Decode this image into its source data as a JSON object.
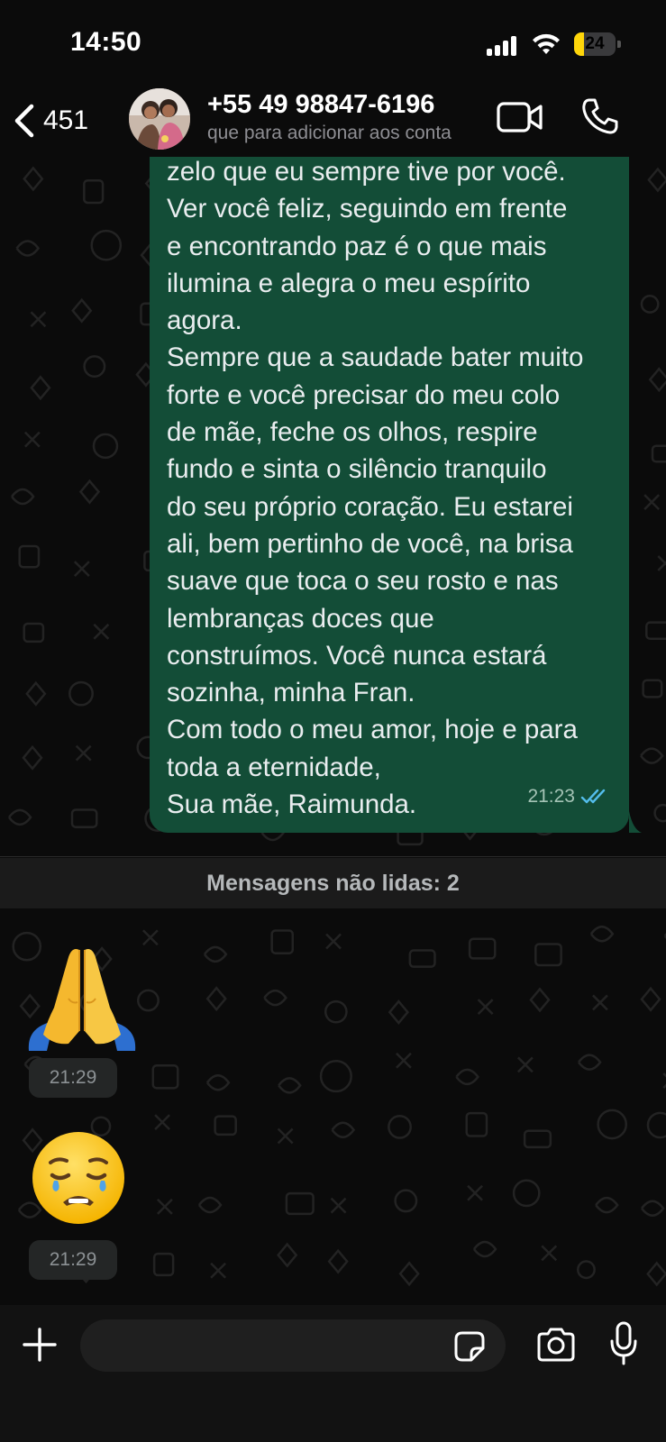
{
  "status_bar": {
    "time": "14:50",
    "battery_level": "24",
    "battery_fraction": 0.24
  },
  "header": {
    "back_count": "451",
    "contact_name": "+55 49 98847-6196",
    "contact_subtitle": "que para adicionar aos conta",
    "icons": [
      "back-chevron-icon",
      "video-call-icon",
      "phone-icon"
    ]
  },
  "outgoing_message": {
    "text": "zelo que eu sempre tive por você.\nVer você feliz, seguindo em frente\ne encontrando paz é o que mais\nilumina e alegra o meu espírito\nagora.\nSempre que a saudade bater muito\nforte e você precisar do meu colo\nde mãe, feche os olhos, respire\nfundo e sinta o silêncio tranquilo\ndo seu próprio coração. Eu estarei\nali, bem pertinho de você, na brisa\nsuave que toca o seu rosto e nas\nlembranças doces que\nconstruímos. Você nunca estará\nsozinha, minha Fran.\nCom todo o meu amor, hoje e para\ntoda a eternidade,\nSua mãe, Raimunda.",
    "time": "21:23",
    "status": "read"
  },
  "unread_divider": {
    "label": "Mensagens não lidas: 2"
  },
  "incoming_messages": [
    {
      "emoji": "folded-hands",
      "time": "21:29"
    },
    {
      "emoji": "disappointed-relieved-face",
      "time": "21:29"
    }
  ],
  "input_bar": {
    "placeholder": "",
    "icons": [
      "plus-icon",
      "sticker-icon",
      "camera-icon",
      "microphone-icon"
    ]
  },
  "colors": {
    "background": "#0b0b0b",
    "outgoing_bubble": "#134d37",
    "read_ticks": "#53bdeb",
    "battery": "#ffd60a"
  }
}
